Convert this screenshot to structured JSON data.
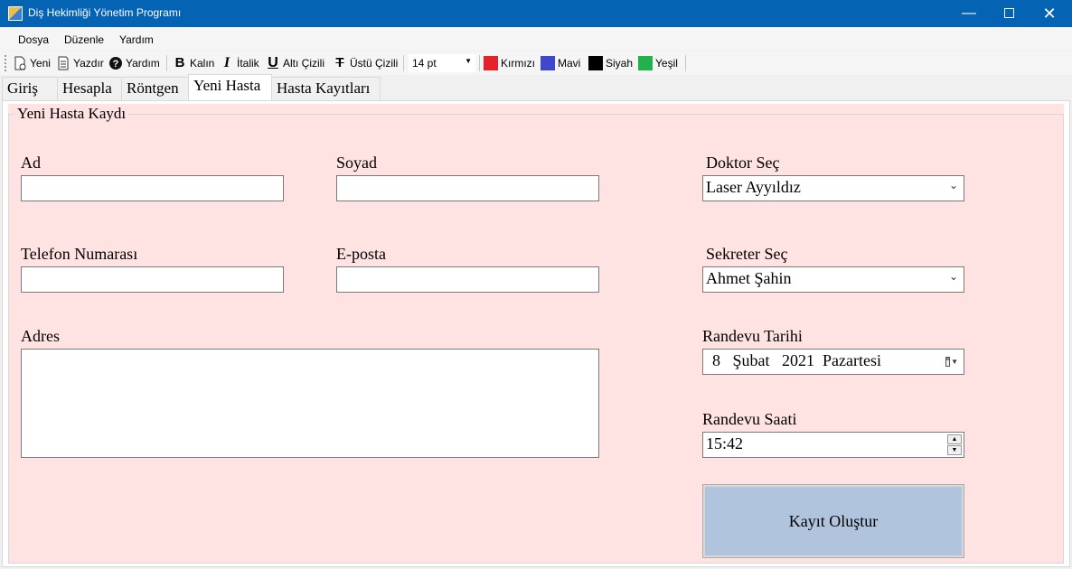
{
  "window": {
    "title": "Diş Hekimliği Yönetim Programı",
    "controls": {
      "minimize": "—",
      "close": "✕"
    }
  },
  "menu": [
    "Dosya",
    "Düzenle",
    "Yardım"
  ],
  "toolbar": {
    "new_label": "Yeni",
    "print_label": "Yazdır",
    "help_label": "Yardım",
    "bold_label": "Kalın",
    "italic_label": "İtalik",
    "underline_label": "Altı Çizili",
    "strike_label": "Üstü Çizili",
    "font_size": "14 pt",
    "colors": [
      {
        "label": "Kırmızı",
        "hex": "#e52229"
      },
      {
        "label": "Mavi",
        "hex": "#3f48cc"
      },
      {
        "label": "Siyah",
        "hex": "#000000"
      },
      {
        "label": "Yeşil",
        "hex": "#22b14c"
      }
    ]
  },
  "tabs": [
    "Giriş",
    "Hesapla",
    "Röntgen",
    "Yeni Hasta",
    "Hasta Kayıtları"
  ],
  "active_tab": "Yeni Hasta",
  "form": {
    "group_title": "Yeni Hasta Kaydı",
    "ad_label": "Ad",
    "ad_value": "",
    "soyad_label": "Soyad",
    "soyad_value": "",
    "telefon_label": "Telefon Numarası",
    "telefon_value": "",
    "eposta_label": "E-posta",
    "eposta_value": "",
    "adres_label": "Adres",
    "adres_value": "",
    "doktor_label": "Doktor Seç",
    "doktor_value": "Laser Ayyıldız",
    "sekreter_label": "Sekreter Seç",
    "sekreter_value": "Ahmet Şahin",
    "tarih_label": "Randevu Tarihi",
    "tarih_day": "8",
    "tarih_month": "Şubat",
    "tarih_year": "2021",
    "tarih_weekday": "Pazartesi",
    "saat_label": "Randevu Saati",
    "saat_value": "15:42",
    "submit_label": "Kayıt Oluştur"
  },
  "colors": {
    "titlebar": "#0563b3",
    "form_background": "#ffe3e3",
    "submit_button": "#b0c4de"
  }
}
